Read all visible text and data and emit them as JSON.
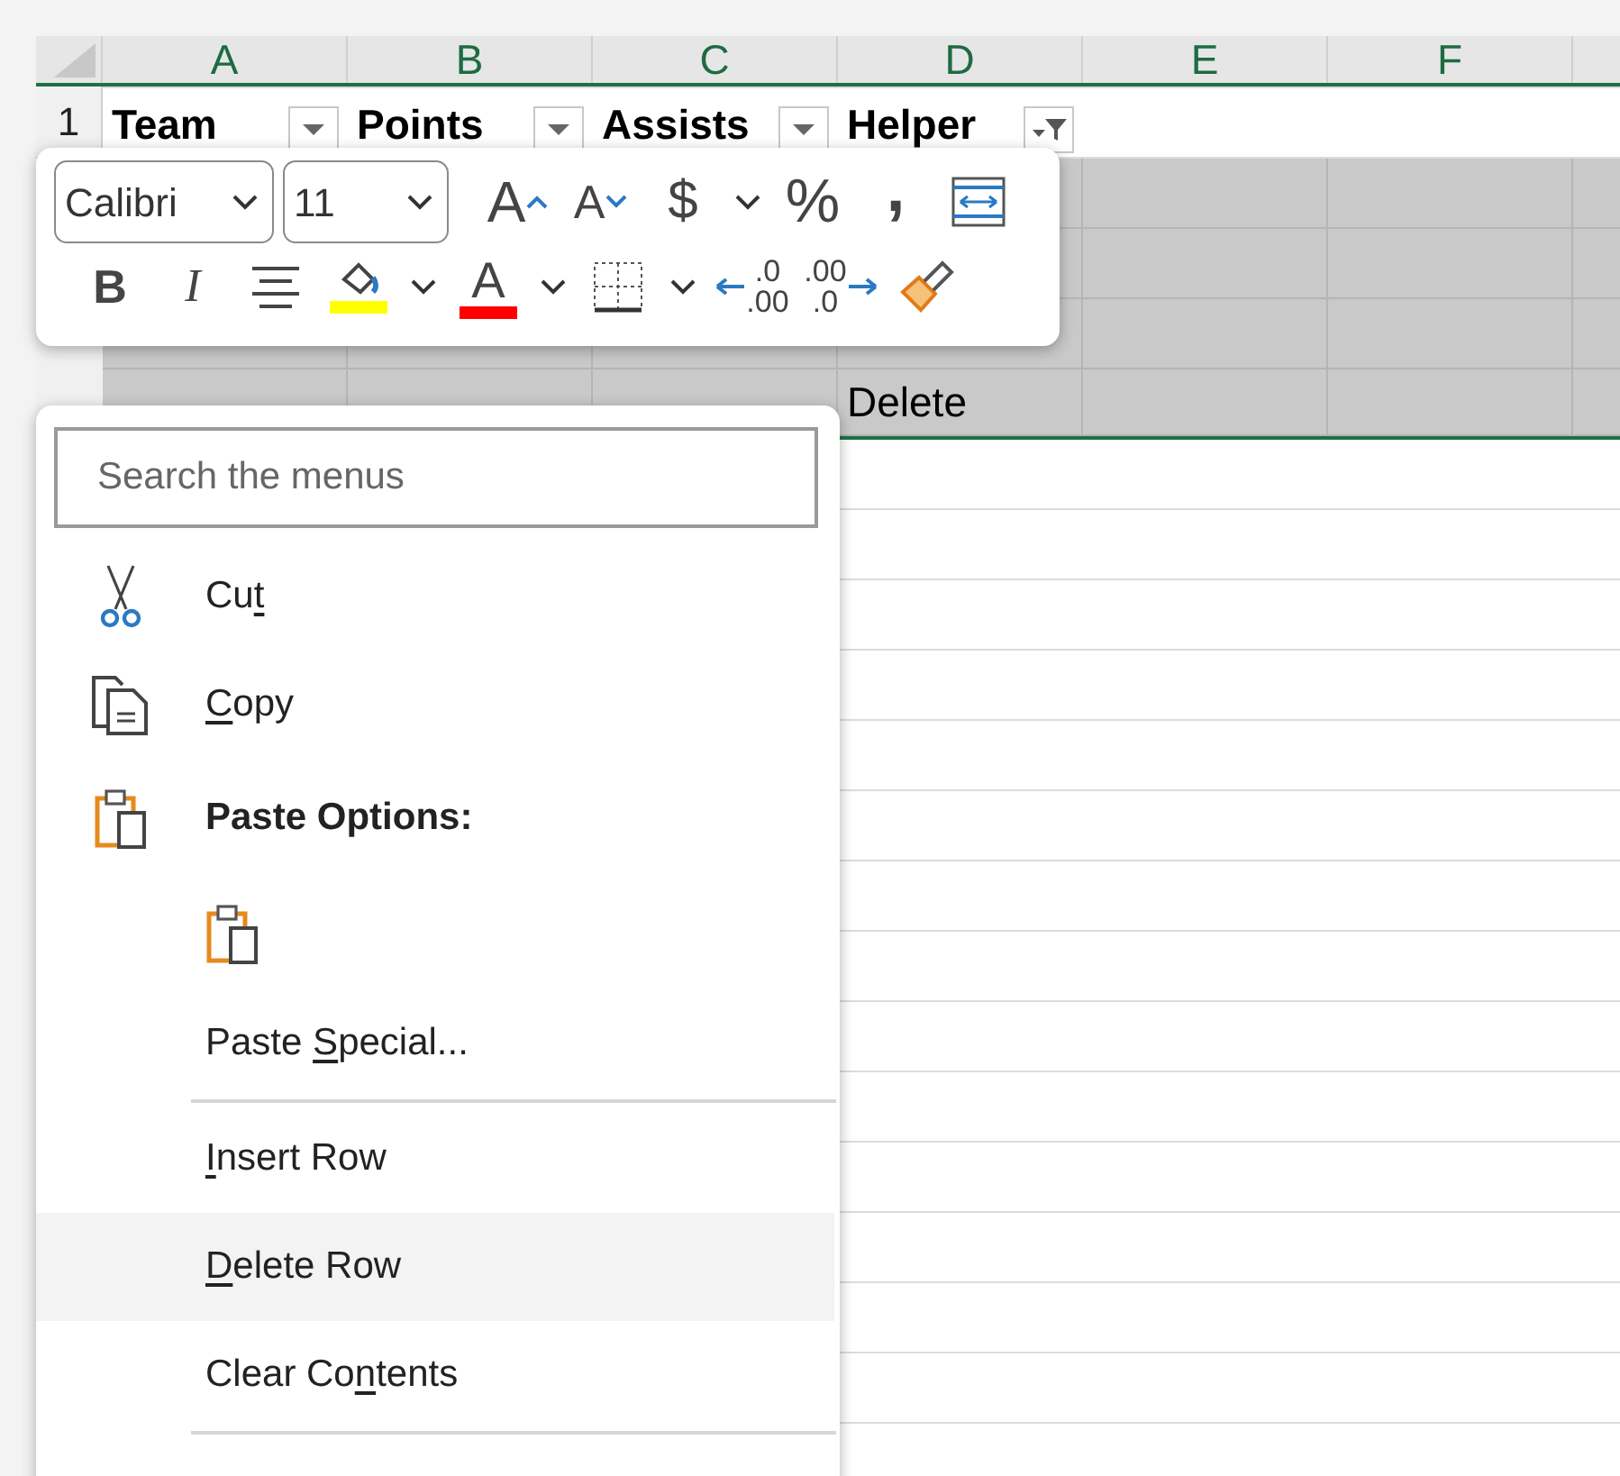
{
  "sheet": {
    "columns": [
      "A",
      "B",
      "C",
      "D",
      "E",
      "F"
    ],
    "rows": [
      {
        "number": "1",
        "selected": false,
        "cells": [
          {
            "text": "Team",
            "filtered": false
          },
          {
            "text": "Points",
            "filtered": false
          },
          {
            "text": "Assists",
            "filtered": false
          },
          {
            "text": "Helper",
            "filtered": true
          }
        ]
      },
      {
        "selected": true,
        "cells": []
      },
      {
        "selected": true,
        "cells": []
      },
      {
        "selected": true,
        "cells": []
      },
      {
        "selected": true,
        "cells": [
          null,
          null,
          null,
          {
            "text": "Delete"
          }
        ]
      }
    ]
  },
  "mini_toolbar": {
    "font": "Calibri",
    "size": "11",
    "row_1": [
      {
        "kind": "grow-font",
        "text": "A",
        "dropdown": false
      },
      {
        "kind": "shrink-font",
        "text": "A",
        "dropdown": false
      },
      {
        "kind": "currency",
        "text": "$",
        "dropdown": true
      },
      {
        "kind": "percent",
        "text": "%",
        "dropdown": false
      },
      {
        "kind": "comma",
        "text": ",",
        "dropdown": false
      },
      {
        "kind": "wrap",
        "dropdown": false
      }
    ],
    "row_2": [
      {
        "kind": "bold",
        "text": "B",
        "dropdown": false
      },
      {
        "kind": "italic",
        "text": "I",
        "dropdown": false
      },
      {
        "kind": "align",
        "dropdown": false
      },
      {
        "kind": "fill-color",
        "color": "#ffff00",
        "dropdown": true
      },
      {
        "kind": "font-color",
        "text": "A",
        "color": "#ff0000",
        "dropdown": true
      },
      {
        "kind": "borders",
        "dropdown": true
      },
      {
        "kind": "decrease-decimal",
        "top": ".0",
        "bottom": ".00",
        "dropdown": false
      },
      {
        "kind": "increase-decimal",
        "top": ".00",
        "bottom": ".0",
        "dropdown": false
      },
      {
        "kind": "format-painter",
        "dropdown": false
      }
    ]
  },
  "context_menu": {
    "search": {
      "placeholder": "Search the menus"
    },
    "items": [
      {
        "kind": "cut",
        "label": {
          "before": "Cu",
          "key": "t"
        },
        "selected": false
      },
      {
        "kind": "copy",
        "label": {
          "key": "C",
          "after": "opy"
        },
        "selected": false
      },
      {
        "kind": "paste-header",
        "label": {
          "before": "Paste Options:"
        },
        "selected": false
      },
      {
        "kind": "paste-option",
        "selected": false
      },
      {
        "kind": "plain",
        "label": {
          "before": "Paste ",
          "key": "S",
          "after": "pecial..."
        },
        "selected": false
      },
      {
        "kind": "separator"
      },
      {
        "kind": "plain",
        "label": {
          "key": "I",
          "after": "nsert Row"
        },
        "selected": false
      },
      {
        "kind": "plain",
        "label": {
          "key": "D",
          "after": "elete Row"
        },
        "selected": true
      },
      {
        "kind": "plain",
        "label": {
          "before": "Clear Co",
          "key": "n",
          "after": "tents"
        },
        "selected": false
      },
      {
        "kind": "separator"
      }
    ]
  }
}
